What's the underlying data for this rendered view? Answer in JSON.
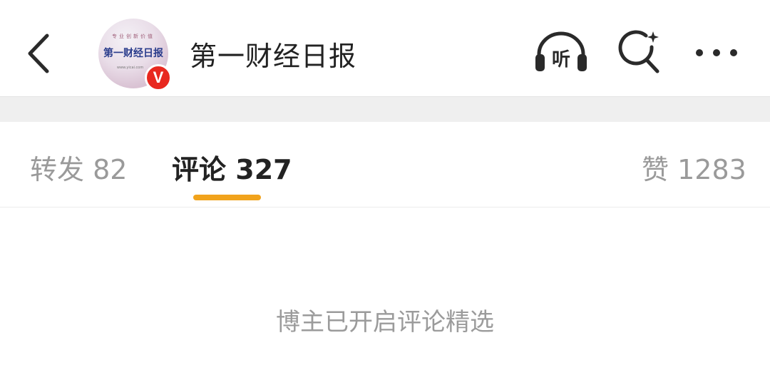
{
  "header": {
    "back_icon": "chevron-left-icon",
    "account_name": "第一财经日报",
    "avatar_logo_text": "第一财经日报",
    "avatar_tiny_text": "专业创新价值",
    "avatar_url_text": "www.yicai.com",
    "verified_badge": "V",
    "verified_color": "#e8281f",
    "listen_label": "听",
    "listen_icon": "headphones-icon",
    "search_icon": "search-sparkle-icon",
    "more_icon": "more-horizontal-icon"
  },
  "tabs": {
    "repost_label": "转发",
    "repost_count": "82",
    "comment_label": "评论",
    "comment_count": "327",
    "like_label": "赞",
    "like_count": "1283",
    "active_tab": "comment",
    "indicator_color": "#f1a31c"
  },
  "main": {
    "notice": "博主已开启评论精选"
  }
}
